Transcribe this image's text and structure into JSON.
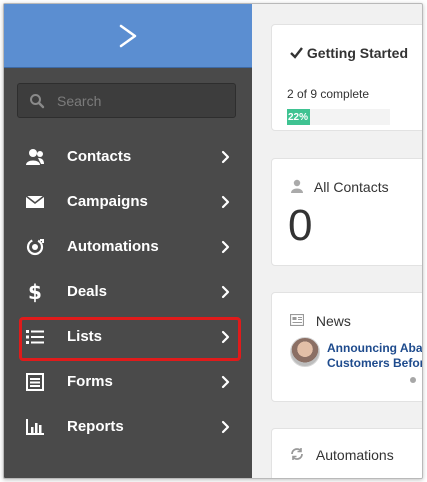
{
  "sidebar": {
    "search": {
      "placeholder": "Search"
    },
    "items": [
      {
        "label": "Contacts",
        "icon": "contacts-icon"
      },
      {
        "label": "Campaigns",
        "icon": "envelope-icon"
      },
      {
        "label": "Automations",
        "icon": "automation-gear-icon"
      },
      {
        "label": "Deals",
        "icon": "dollar-icon"
      },
      {
        "label": "Lists",
        "icon": "list-icon",
        "highlighted": true
      },
      {
        "label": "Forms",
        "icon": "form-icon"
      },
      {
        "label": "Reports",
        "icon": "bar-chart-icon"
      }
    ]
  },
  "cards": {
    "getting_started": {
      "title": "Getting Started",
      "progress_text": "2 of 9 complete",
      "progress_label": "22%",
      "progress_fraction": 0.22
    },
    "all_contacts": {
      "title": "All Contacts",
      "count": "0"
    },
    "news": {
      "title": "News",
      "link_line1": "Announcing Aba",
      "link_line2": "Customers Befor"
    },
    "automations": {
      "title": "Automations"
    }
  },
  "colors": {
    "sidebar_bg": "#4a4a4a",
    "brand_bg": "#5b8ed1",
    "progress_green": "#3fc392",
    "highlight_red": "#e01b1b",
    "link_blue": "#1e4b8d"
  }
}
